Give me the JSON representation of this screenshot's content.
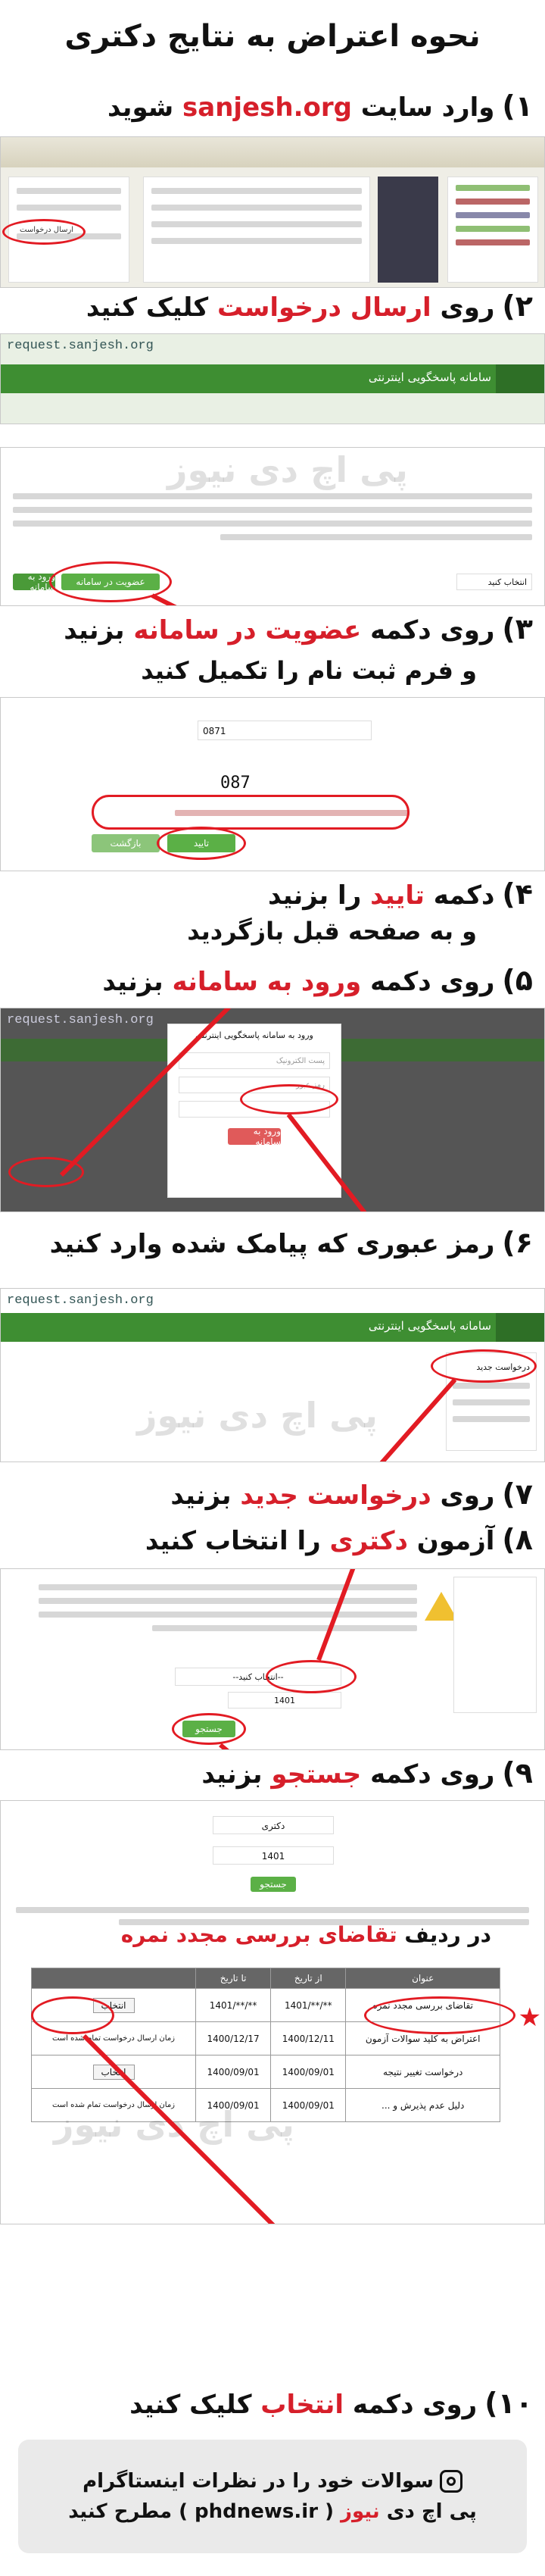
{
  "title": "نحوه اعتراض به نتایج دکتری",
  "steps": {
    "s1": {
      "num": "۱)",
      "pre": "وارد سایت ",
      "red": "sanjesh.org",
      "post": " شوید"
    },
    "s2": {
      "num": "۲)",
      "pre": "روی ",
      "red": "ارسال درخواست",
      "post": " کلیک کنید"
    },
    "s3": {
      "num": "۳)",
      "pre": "روی دکمه ",
      "red": "عضویت در سامانه",
      "post": " بزنید",
      "sub": "و فرم ثبت نام را تکمیل کنید"
    },
    "s4": {
      "num": "۴)",
      "pre": "دکمه ",
      "red": "تایید",
      "post": " را بزنید",
      "sub": "و به صفحه قبل بازگردید"
    },
    "s5": {
      "num": "۵)",
      "pre": "روی دکمه ",
      "red": "ورود به سامانه",
      "post": " بزنید"
    },
    "s6": {
      "num": "۶)",
      "text": "رمز عبوری که پیامک شده وارد کنید"
    },
    "s7": {
      "num": "۷)",
      "pre": "روی ",
      "red": "درخواست جدید",
      "post": " بزنید"
    },
    "s8": {
      "num": "۸)",
      "pre": "آزمون ",
      "red": "دکتری",
      "post": " را انتخاب کنید"
    },
    "s9": {
      "num": "۹)",
      "pre": "روی دکمه ",
      "red": "جستجو",
      "post": " بزنید"
    },
    "s10": {
      "num": "۱۰)",
      "pre": "روی دکمه ",
      "red": "انتخاب",
      "post": " کلیک کنید"
    }
  },
  "screens": {
    "url": "request.sanjesh.org",
    "header_brand": "سامانه پاسخگویی اینترنتی",
    "watermark": "پی اچ دی نیوز",
    "send_request_link": "ارسال درخواست",
    "membership_button": "عضویت در سامانه",
    "login_button": "ورود به سامانه",
    "confirm_button": "تایید",
    "return_button": "بازگشت",
    "captcha": "087",
    "phone_value": "0871",
    "login_title": "ورود به سامانه پاسخگویی اینترنتی",
    "login_user_placeholder": "پست الکترونیک",
    "login_pass_placeholder": "رمز عبور",
    "new_request": "درخواست جدید",
    "exam_select": "--انتخاب کنید--",
    "year_value": "1401",
    "search_button": "جستجو",
    "exam_selected": "دکتری",
    "select_placeholder": "انتخاب کنید",
    "row_hint": "در ردیف ",
    "row_hint_red": "تقاضای بررسی مجدد نمره",
    "table_headers": [
      "عنوان",
      "از تاریخ",
      "تا تاریخ",
      ""
    ],
    "table_rows": [
      {
        "title": "تقاضای بررسی مجدد نمره",
        "from": "1401/**/**",
        "to": "1401/**/**",
        "action": "انتخاب"
      },
      {
        "title": "اعتراض به کلید سوالات آزمون",
        "from": "1400/12/11",
        "to": "1400/12/17",
        "action": "زمان ارسال درخواست تمام شده است"
      },
      {
        "title": "درخواست تغییر نتیجه",
        "from": "1400/09/01",
        "to": "1400/09/01",
        "action": "انتخاب"
      },
      {
        "title": "دلیل عدم پذیرش و ...",
        "from": "1400/09/01",
        "to": "1400/09/01",
        "action": "زمان ارسال درخواست تمام شده است"
      }
    ]
  },
  "footer": {
    "line1": "سوالات خود را در نظرات اینستاگرام",
    "line2_pre": "پی اچ دی ",
    "line2_red": "نیوز",
    "line2_post": " ( phdnews.ir ) مطرح کنید"
  }
}
